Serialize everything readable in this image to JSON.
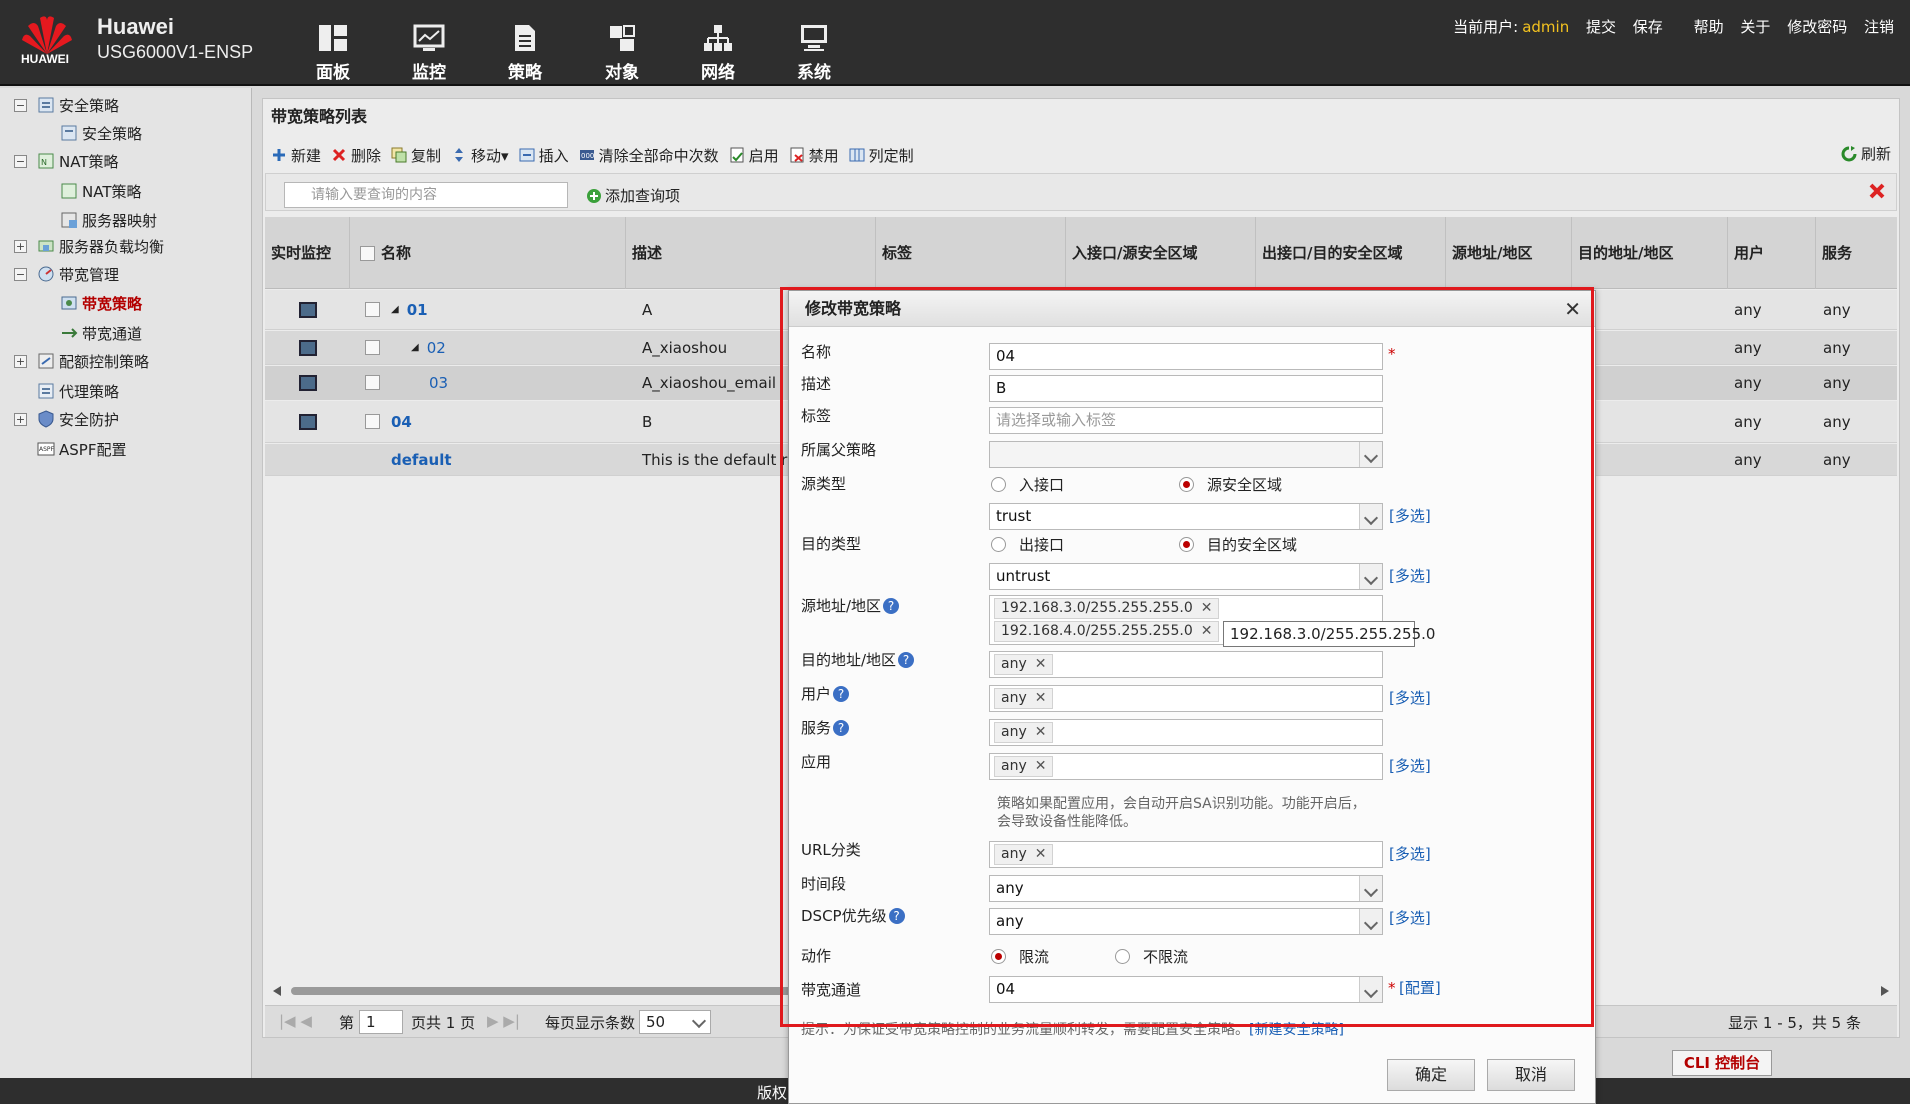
{
  "brand": {
    "logo_text": "HUAWEI",
    "name": "Huawei",
    "model": "USG6000V1-ENSP"
  },
  "nav": [
    {
      "label": "面板",
      "icon": "dashboard-icon"
    },
    {
      "label": "监控",
      "icon": "monitor-icon"
    },
    {
      "label": "策略",
      "icon": "policy-icon"
    },
    {
      "label": "对象",
      "icon": "object-icon"
    },
    {
      "label": "网络",
      "icon": "network-icon"
    },
    {
      "label": "系统",
      "icon": "system-icon"
    }
  ],
  "topright": {
    "user_label": "当前用户:",
    "user": "admin",
    "submit": "提交",
    "save": "保存",
    "help": "帮助",
    "about": "关于",
    "change_pwd": "修改密码",
    "logout": "注销"
  },
  "sidebar": [
    {
      "label": "安全策略",
      "toggle": "−"
    },
    {
      "label": "安全策略"
    },
    {
      "label": "NAT策略",
      "toggle": "−"
    },
    {
      "label": "NAT策略"
    },
    {
      "label": "服务器映射"
    },
    {
      "label": "服务器负载均衡",
      "toggle": "+"
    },
    {
      "label": "带宽管理",
      "toggle": "−"
    },
    {
      "label": "带宽策略",
      "active": true
    },
    {
      "label": "带宽通道"
    },
    {
      "label": "配额控制策略",
      "toggle": "+"
    },
    {
      "label": "代理策略"
    },
    {
      "label": "安全防护",
      "toggle": "+"
    },
    {
      "label": "ASPF配置"
    }
  ],
  "main": {
    "title": "带宽策略列表",
    "toolbar": {
      "new": "新建",
      "delete": "删除",
      "copy": "复制",
      "move": "移动▾",
      "insert": "插入",
      "clear_hits": "清除全部命中次数",
      "enable": "启用",
      "disable": "禁用",
      "columns": "列定制",
      "refresh": "刷新"
    },
    "search_placeholder": "请输入要查询的内容",
    "add_query": "添加查询项",
    "columns": [
      "实时监控",
      "名称",
      "描述",
      "标签",
      "入接口/源安全区域",
      "出接口/目的安全区域",
      "源地址/地区",
      "目的地址/地区",
      "用户",
      "服务"
    ],
    "rows": [
      {
        "name": "01",
        "desc": "A",
        "user": "any",
        "service": "any"
      },
      {
        "name": "02",
        "desc": "A_xiaoshou",
        "user": "any",
        "service": "any"
      },
      {
        "name": "03",
        "desc": "A_xiaoshou_email",
        "user": "any",
        "service": "any"
      },
      {
        "name": "04",
        "desc": "B",
        "user": "any",
        "service": "any"
      },
      {
        "name": "default",
        "desc": "This is the default rule",
        "user": "any",
        "service": "any"
      }
    ],
    "pager": {
      "page_prefix": "第",
      "page": "1",
      "page_suffix": "页共 1 页",
      "per_page_label": "每页显示条数",
      "per_page": "50",
      "summary": "显示 1 - 5，共 5 条"
    }
  },
  "footer": {
    "text": "版权",
    "cli": "CLI 控制台"
  },
  "dialog": {
    "title": "修改带宽策略",
    "fields": {
      "name_label": "名称",
      "name": "04",
      "desc_label": "描述",
      "desc": "B",
      "tag_label": "标签",
      "tag_placeholder": "请选择或输入标签",
      "parent_label": "所属父策略",
      "src_type_label": "源类型",
      "src_opt1": "入接口",
      "src_opt2": "源安全区域",
      "src_zone": "trust",
      "dst_type_label": "目的类型",
      "dst_opt1": "出接口",
      "dst_opt2": "目的安全区域",
      "dst_zone": "untrust",
      "src_addr_label": "源地址/地区",
      "src_addr": [
        "192.168.3.0/255.255.255.0",
        "192.168.4.0/255.255.255.0"
      ],
      "tooltip": "192.168.3.0/255.255.255.0",
      "dst_addr_label": "目的地址/地区",
      "dst_addr": "any",
      "user_label": "用户",
      "user": "any",
      "service_label": "服务",
      "service": "any",
      "app_label": "应用",
      "app": "any",
      "app_note": "策略如果配置应用，会自动开启SA识别功能。功能开启后，会导致设备性能降低。",
      "url_label": "URL分类",
      "url": "any",
      "time_label": "时间段",
      "time": "any",
      "dscp_label": "DSCP优先级",
      "dscp": "any",
      "action_label": "动作",
      "action_opt1": "限流",
      "action_opt2": "不限流",
      "channel_label": "带宽通道",
      "channel": "04",
      "multi": "[多选]",
      "config": "[配置]",
      "help": "?",
      "req": "*"
    },
    "tip": "提示：为保证受带宽策略控制的业务流量顺利转发，需要配置安全策略。",
    "tip_link": "[新建安全策略]",
    "ok": "确定",
    "cancel": "取消"
  }
}
